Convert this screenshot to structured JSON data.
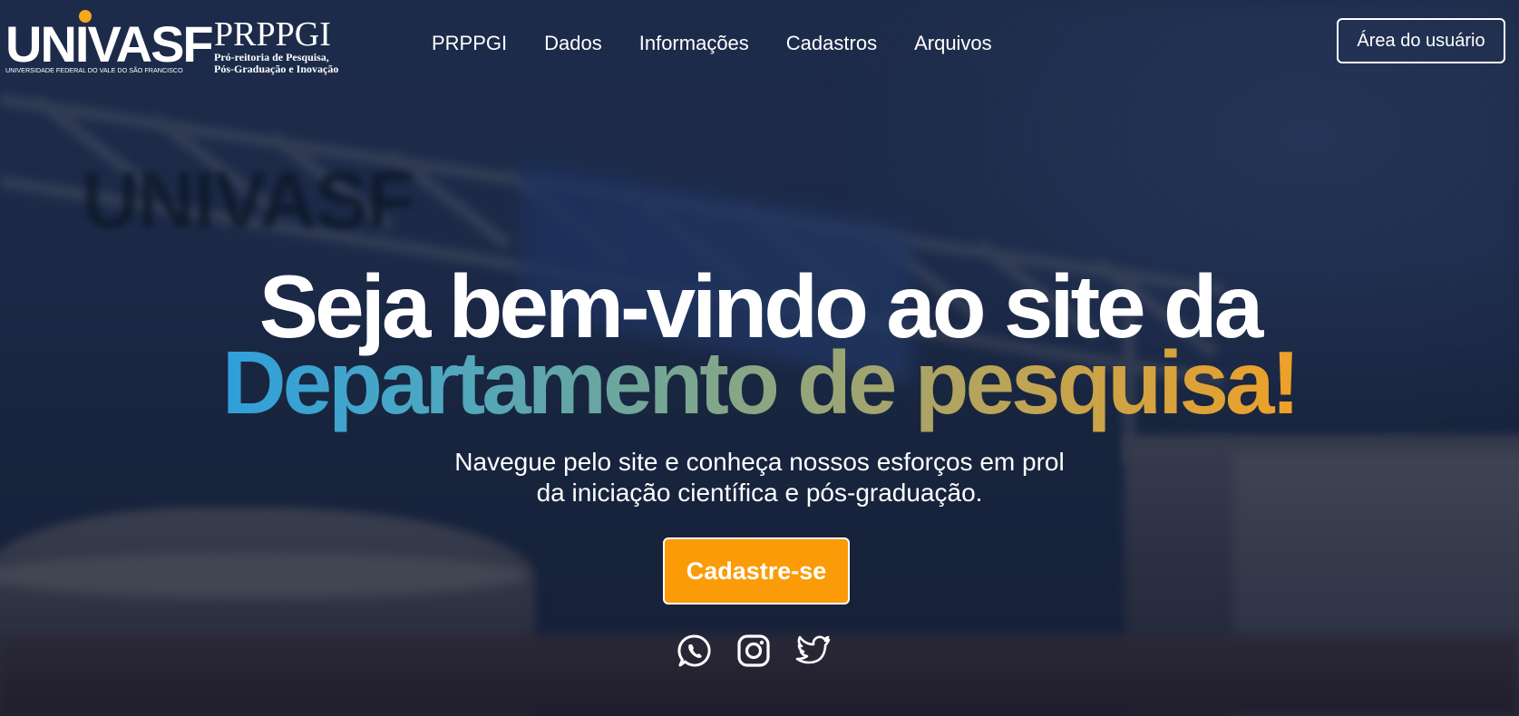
{
  "header": {
    "logo": {
      "brand": "UNIVASF",
      "brand_subtitle": "UNIVERSIDADE FEDERAL DO VALE DO SÃO FRANCISCO",
      "dept": "PRPPGI",
      "dept_line1": "Pró-reitoria de Pesquisa,",
      "dept_line2": "Pós-Graduação e Inovação"
    },
    "nav": [
      "PRPPGI",
      "Dados",
      "Informações",
      "Cadastros",
      "Arquivos"
    ],
    "user_area_label": "Área do usuário"
  },
  "hero": {
    "title_line1": "Seja bem-vindo ao site da",
    "title_line2": "Departamento de pesquisa!",
    "subtitle_line1": "Navegue pelo site e conheça nossos esforços em prol",
    "subtitle_line2": "da iniciação científica e pós-graduação.",
    "cta_label": "Cadastre-se"
  },
  "social": [
    "whatsapp-icon",
    "instagram-icon",
    "twitter-icon"
  ],
  "colors": {
    "accent_orange": "#fb9b07",
    "gradient_start": "#2f9fda",
    "gradient_end": "#eea128",
    "logo_dot": "#f7a81b"
  }
}
